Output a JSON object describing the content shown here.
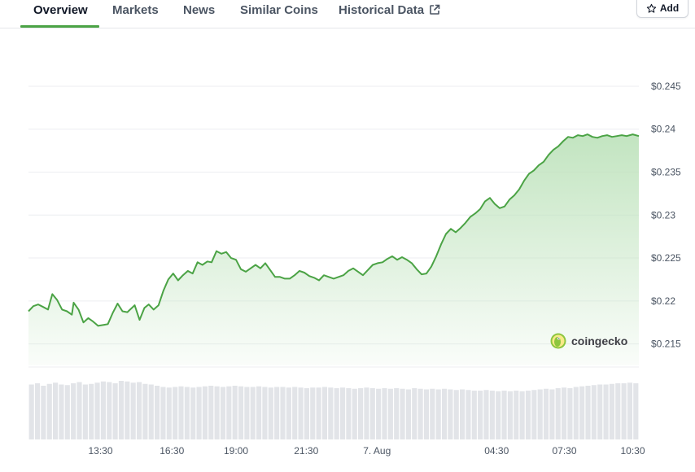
{
  "tabs": [
    {
      "label": "Overview",
      "active": true
    },
    {
      "label": "Markets",
      "active": false
    },
    {
      "label": "News",
      "active": false
    },
    {
      "label": "Similar Coins",
      "active": false
    },
    {
      "label": "Historical Data",
      "active": false
    }
  ],
  "add_button": {
    "label": "Add"
  },
  "brand": {
    "name": "coingecko"
  },
  "colors": {
    "line": "#4ba345",
    "fill_top": "#bfe3bd",
    "volume": "#e2e4e8",
    "grid": "#eceef1",
    "accent": "#4ba345"
  },
  "chart_data": {
    "type": "area",
    "ylim": [
      0.2125,
      0.2485
    ],
    "yticks": [
      {
        "value": 0.245,
        "label": "$0.245"
      },
      {
        "value": 0.24,
        "label": "$0.24"
      },
      {
        "value": 0.235,
        "label": "$0.235"
      },
      {
        "value": 0.23,
        "label": "$0.23"
      },
      {
        "value": 0.225,
        "label": "$0.225"
      },
      {
        "value": 0.22,
        "label": "$0.22"
      },
      {
        "value": 0.215,
        "label": "$0.215"
      }
    ],
    "xlim": [
      0,
      100
    ],
    "xticks": [
      {
        "x": 11.8,
        "label": "13:30"
      },
      {
        "x": 23.5,
        "label": "16:30"
      },
      {
        "x": 34.0,
        "label": "19:00"
      },
      {
        "x": 45.5,
        "label": "21:30"
      },
      {
        "x": 57.1,
        "label": "7. Aug"
      },
      {
        "x": 76.7,
        "label": "04:30"
      },
      {
        "x": 87.8,
        "label": "07:30"
      },
      {
        "x": 99.0,
        "label": "10:30"
      }
    ],
    "price": [
      [
        0,
        0.2188
      ],
      [
        0.8,
        0.2194
      ],
      [
        1.6,
        0.2196
      ],
      [
        2.4,
        0.2193
      ],
      [
        3.2,
        0.219
      ],
      [
        3.9,
        0.2208
      ],
      [
        4.7,
        0.2201
      ],
      [
        5.5,
        0.219
      ],
      [
        6.3,
        0.2188
      ],
      [
        7.1,
        0.2184
      ],
      [
        7.4,
        0.2198
      ],
      [
        8.2,
        0.219
      ],
      [
        9,
        0.2175
      ],
      [
        9.8,
        0.218
      ],
      [
        10.6,
        0.2176
      ],
      [
        11.4,
        0.2171
      ],
      [
        12.2,
        0.2172
      ],
      [
        13,
        0.2173
      ],
      [
        13.8,
        0.2186
      ],
      [
        14.6,
        0.2197
      ],
      [
        15.4,
        0.2188
      ],
      [
        16.2,
        0.2187
      ],
      [
        17.4,
        0.2195
      ],
      [
        18.2,
        0.2178
      ],
      [
        19,
        0.2192
      ],
      [
        19.7,
        0.2196
      ],
      [
        20.5,
        0.219
      ],
      [
        21.3,
        0.2195
      ],
      [
        22.1,
        0.2212
      ],
      [
        22.9,
        0.2225
      ],
      [
        23.7,
        0.2232
      ],
      [
        24.5,
        0.2224
      ],
      [
        25.3,
        0.223
      ],
      [
        26.1,
        0.2235
      ],
      [
        26.9,
        0.2232
      ],
      [
        27.7,
        0.2245
      ],
      [
        28.5,
        0.2242
      ],
      [
        29.3,
        0.2246
      ],
      [
        30,
        0.2245
      ],
      [
        30.8,
        0.2258
      ],
      [
        31.6,
        0.2255
      ],
      [
        32.4,
        0.2257
      ],
      [
        33.2,
        0.225
      ],
      [
        34,
        0.2248
      ],
      [
        34.8,
        0.2237
      ],
      [
        35.6,
        0.2234
      ],
      [
        36.4,
        0.2238
      ],
      [
        37.2,
        0.2242
      ],
      [
        38,
        0.2238
      ],
      [
        38.8,
        0.2244
      ],
      [
        39.6,
        0.2236
      ],
      [
        40.4,
        0.2228
      ],
      [
        41.2,
        0.2228
      ],
      [
        42,
        0.2226
      ],
      [
        42.8,
        0.2226
      ],
      [
        43.6,
        0.223
      ],
      [
        44.4,
        0.2235
      ],
      [
        45.2,
        0.2233
      ],
      [
        46,
        0.2229
      ],
      [
        46.8,
        0.2227
      ],
      [
        47.6,
        0.2224
      ],
      [
        48.4,
        0.223
      ],
      [
        49.2,
        0.2228
      ],
      [
        50,
        0.2226
      ],
      [
        50.8,
        0.2228
      ],
      [
        51.6,
        0.223
      ],
      [
        52.4,
        0.2235
      ],
      [
        53.2,
        0.2238
      ],
      [
        54,
        0.2234
      ],
      [
        54.8,
        0.223
      ],
      [
        55.6,
        0.2236
      ],
      [
        56.4,
        0.2242
      ],
      [
        57.2,
        0.2244
      ],
      [
        58,
        0.2245
      ],
      [
        58.8,
        0.2249
      ],
      [
        59.6,
        0.2252
      ],
      [
        60.4,
        0.2248
      ],
      [
        61.2,
        0.2251
      ],
      [
        62,
        0.2248
      ],
      [
        62.8,
        0.2244
      ],
      [
        63.6,
        0.2237
      ],
      [
        64.4,
        0.2231
      ],
      [
        65.2,
        0.2232
      ],
      [
        66,
        0.224
      ],
      [
        66.8,
        0.2252
      ],
      [
        67.6,
        0.2266
      ],
      [
        68.4,
        0.2278
      ],
      [
        69.2,
        0.2284
      ],
      [
        70,
        0.228
      ],
      [
        70.8,
        0.2285
      ],
      [
        71.6,
        0.2291
      ],
      [
        72.4,
        0.2298
      ],
      [
        73.2,
        0.2302
      ],
      [
        74,
        0.2307
      ],
      [
        74.8,
        0.2316
      ],
      [
        75.6,
        0.232
      ],
      [
        76.4,
        0.2313
      ],
      [
        77.2,
        0.2308
      ],
      [
        78,
        0.231
      ],
      [
        78.8,
        0.2318
      ],
      [
        79.6,
        0.2323
      ],
      [
        80.4,
        0.233
      ],
      [
        81.2,
        0.234
      ],
      [
        82,
        0.2348
      ],
      [
        82.8,
        0.2352
      ],
      [
        83.6,
        0.2358
      ],
      [
        84.4,
        0.2362
      ],
      [
        85.2,
        0.237
      ],
      [
        86,
        0.2376
      ],
      [
        86.8,
        0.238
      ],
      [
        87.6,
        0.2386
      ],
      [
        88.4,
        0.2391
      ],
      [
        89.2,
        0.239
      ],
      [
        90,
        0.2393
      ],
      [
        90.8,
        0.2392
      ],
      [
        91.6,
        0.2394
      ],
      [
        92.4,
        0.2391
      ],
      [
        93.2,
        0.239
      ],
      [
        94,
        0.2392
      ],
      [
        94.8,
        0.2393
      ],
      [
        95.6,
        0.2391
      ],
      [
        96.4,
        0.2392
      ],
      [
        97.2,
        0.2393
      ],
      [
        98,
        0.2392
      ],
      [
        99,
        0.2394
      ],
      [
        100,
        0.2392
      ]
    ],
    "volume": [
      0.9,
      0.92,
      0.88,
      0.91,
      0.93,
      0.9,
      0.89,
      0.92,
      0.94,
      0.9,
      0.91,
      0.93,
      0.95,
      0.94,
      0.92,
      0.96,
      0.95,
      0.93,
      0.94,
      0.91,
      0.9,
      0.88,
      0.86,
      0.85,
      0.86,
      0.87,
      0.86,
      0.85,
      0.86,
      0.87,
      0.88,
      0.87,
      0.86,
      0.87,
      0.88,
      0.87,
      0.86,
      0.86,
      0.87,
      0.86,
      0.85,
      0.86,
      0.86,
      0.85,
      0.86,
      0.85,
      0.84,
      0.85,
      0.85,
      0.86,
      0.85,
      0.84,
      0.85,
      0.84,
      0.83,
      0.84,
      0.85,
      0.84,
      0.83,
      0.84,
      0.83,
      0.84,
      0.83,
      0.82,
      0.84,
      0.83,
      0.82,
      0.83,
      0.82,
      0.83,
      0.82,
      0.81,
      0.82,
      0.81,
      0.8,
      0.8,
      0.81,
      0.8,
      0.79,
      0.8,
      0.79,
      0.8,
      0.79,
      0.8,
      0.81,
      0.82,
      0.83,
      0.82,
      0.84,
      0.85,
      0.84,
      0.86,
      0.87,
      0.88,
      0.89,
      0.9,
      0.9,
      0.91,
      0.92,
      0.92,
      0.93,
      0.92
    ]
  }
}
